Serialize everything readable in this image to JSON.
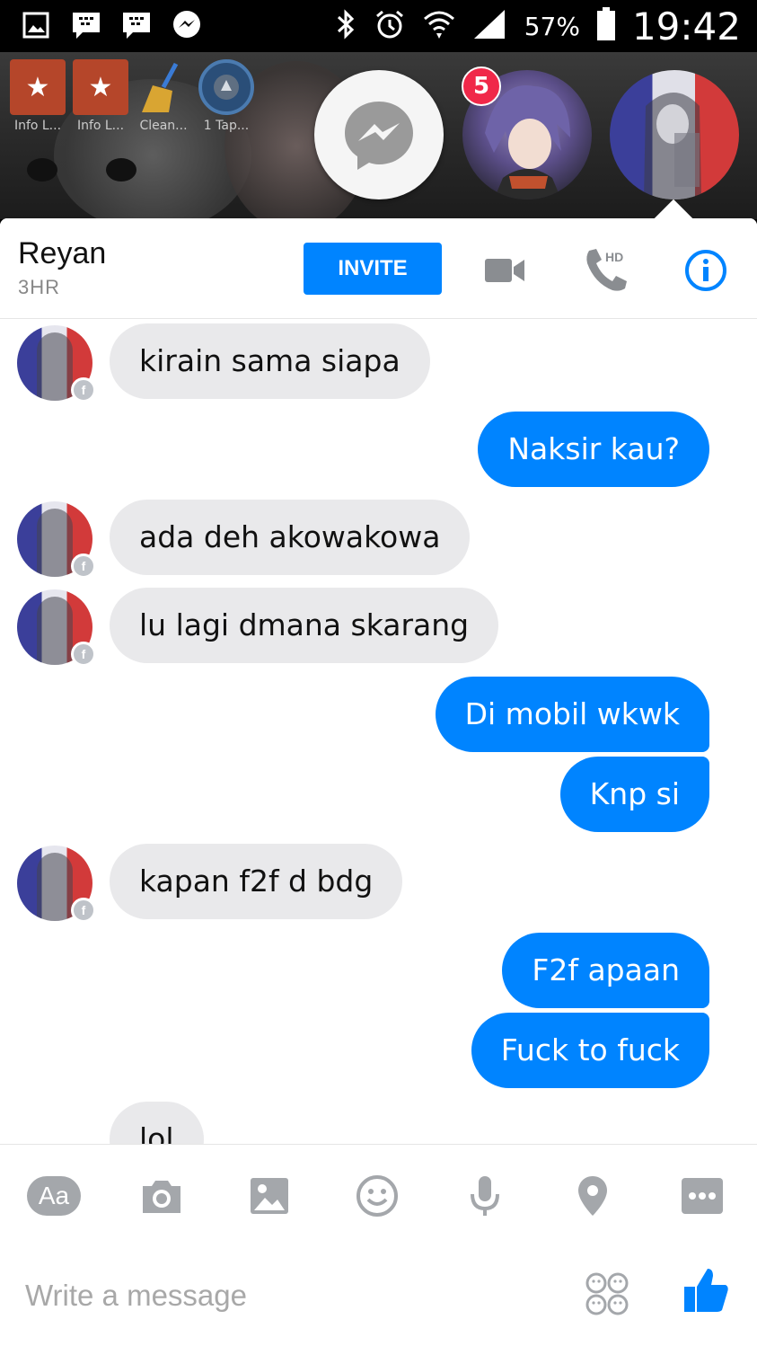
{
  "status_bar": {
    "battery": "57%",
    "time": "19:42"
  },
  "launcher": {
    "items": [
      {
        "label": "Info L...",
        "icon": "star-icon"
      },
      {
        "label": "Info L...",
        "icon": "star-icon"
      },
      {
        "label": "Clean...",
        "icon": "broom-icon"
      },
      {
        "label": "1 Tap...",
        "icon": "rocket-icon"
      }
    ]
  },
  "chat_heads": {
    "unread_badge": "5"
  },
  "header": {
    "name": "Reyan",
    "subtitle": "3HR",
    "invite_label": "INVITE",
    "hd_label": "HD"
  },
  "messages": [
    {
      "dir": "in",
      "text": "kirain sama siapa"
    },
    {
      "dir": "out",
      "text": "Naksir kau?"
    },
    {
      "dir": "in",
      "text": "ada deh akowakowa"
    },
    {
      "dir": "in",
      "text": "lu lagi dmana skarang"
    },
    {
      "dir": "out",
      "text": "Di mobil wkwk"
    },
    {
      "dir": "out",
      "text": "Knp si"
    },
    {
      "dir": "in",
      "text": "kapan f2f d bdg"
    },
    {
      "dir": "out",
      "text": "F2f apaan"
    },
    {
      "dir": "out",
      "text": "Fuck to fuck"
    },
    {
      "dir": "in",
      "text": "lol"
    }
  ],
  "toolbar": {
    "aa_label": "Aa"
  },
  "composer": {
    "placeholder": "Write a message"
  },
  "colors": {
    "accent": "#0084ff",
    "incoming_bubble": "#e9e9eb",
    "icon_gray": "#a4a7ab"
  }
}
